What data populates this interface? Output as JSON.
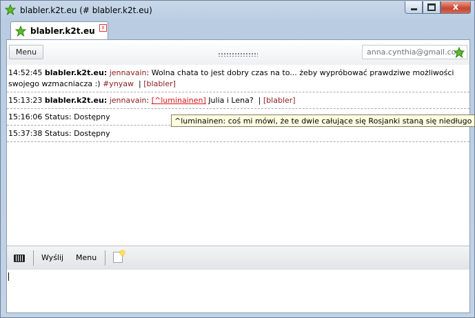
{
  "window": {
    "title": "blabler.k2t.eu (# blabler.k2t.eu)",
    "minimize": "",
    "maximize": "",
    "close": "x"
  },
  "tab": {
    "label": "blabler.k2t.eu",
    "close": "x"
  },
  "toolbar": {
    "menu_label": "Menu",
    "account_email": "anna.cynthia@gmail.com"
  },
  "messages": [
    {
      "time": "14:52:45",
      "channel": "blabler.k2t.eu",
      "author": "jennavain",
      "text": "Wolna chata to jest dobry czas na to... żeby wypróbować prawdziwe możliwości swojego wzmacniacza :)",
      "hashtag": "#ynyaw",
      "source": "[blabler]"
    },
    {
      "time": "15:13:23",
      "channel": "blabler.k2t.eu",
      "author": "jennavain",
      "mention": "[^luminainen]",
      "text": "Julia i Lena?",
      "source": "[blabler]"
    },
    {
      "time": "15:16:06",
      "status": "Status: Dostępny"
    },
    {
      "time": "15:37:38",
      "status": "Status: Dostępny"
    }
  ],
  "tooltip": {
    "text": "^luminainen: coś mi mówi, że te dwie całujące się Rosjanki staną się niedługo popy"
  },
  "inputbar": {
    "send_label": "Wyślij",
    "menu_label": "Menu"
  },
  "colors": {
    "accent_link": "#d31616",
    "author": "#8b1a1a",
    "tooltip_bg": "#fffee1"
  }
}
